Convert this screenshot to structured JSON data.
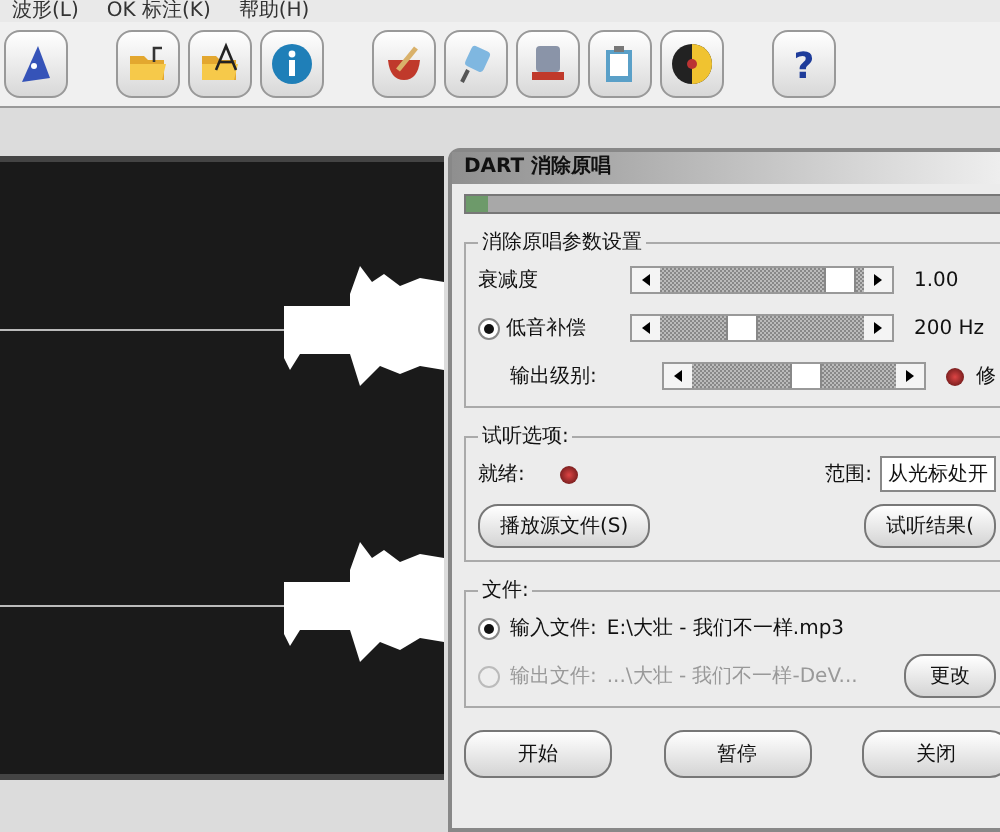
{
  "menu": [
    "波形(L)",
    "OK 标注(K)",
    "帮助(H)"
  ],
  "help_glyph": "?",
  "dialog": {
    "title": "DART 消除原唱",
    "progress": {
      "level": 0.04
    },
    "params": {
      "legend": "消除原唱参数设置",
      "rows": [
        {
          "kind": "plain",
          "label": "衰减度",
          "level": 0.93,
          "reading": "1.00"
        },
        {
          "kind": "radio",
          "label": "低音补偿",
          "selected": true,
          "level": 0.38,
          "reading": "200 Hz"
        },
        {
          "kind": "lamp",
          "label": "输出级别:",
          "level": 0.56,
          "reading": "修"
        }
      ]
    },
    "preview": {
      "legend": "试听选项:",
      "status_label": "就绪:",
      "range_label": "范围:",
      "range_value": "从光标处开",
      "buttons": [
        "播放源文件(S)",
        "试听结果("
      ]
    },
    "files": {
      "legend": "文件:",
      "rows": [
        {
          "label": "输入文件:",
          "path": "E:\\大壮 - 我们不一样.mp3",
          "selected": true,
          "disabled": false
        },
        {
          "label": "输出文件:",
          "path": "...\\大壮 - 我们不一样-DeV...",
          "selected": false,
          "disabled": true
        }
      ],
      "change_button": "更改"
    },
    "buttons": [
      "开始",
      "暂停",
      "关闭"
    ]
  }
}
